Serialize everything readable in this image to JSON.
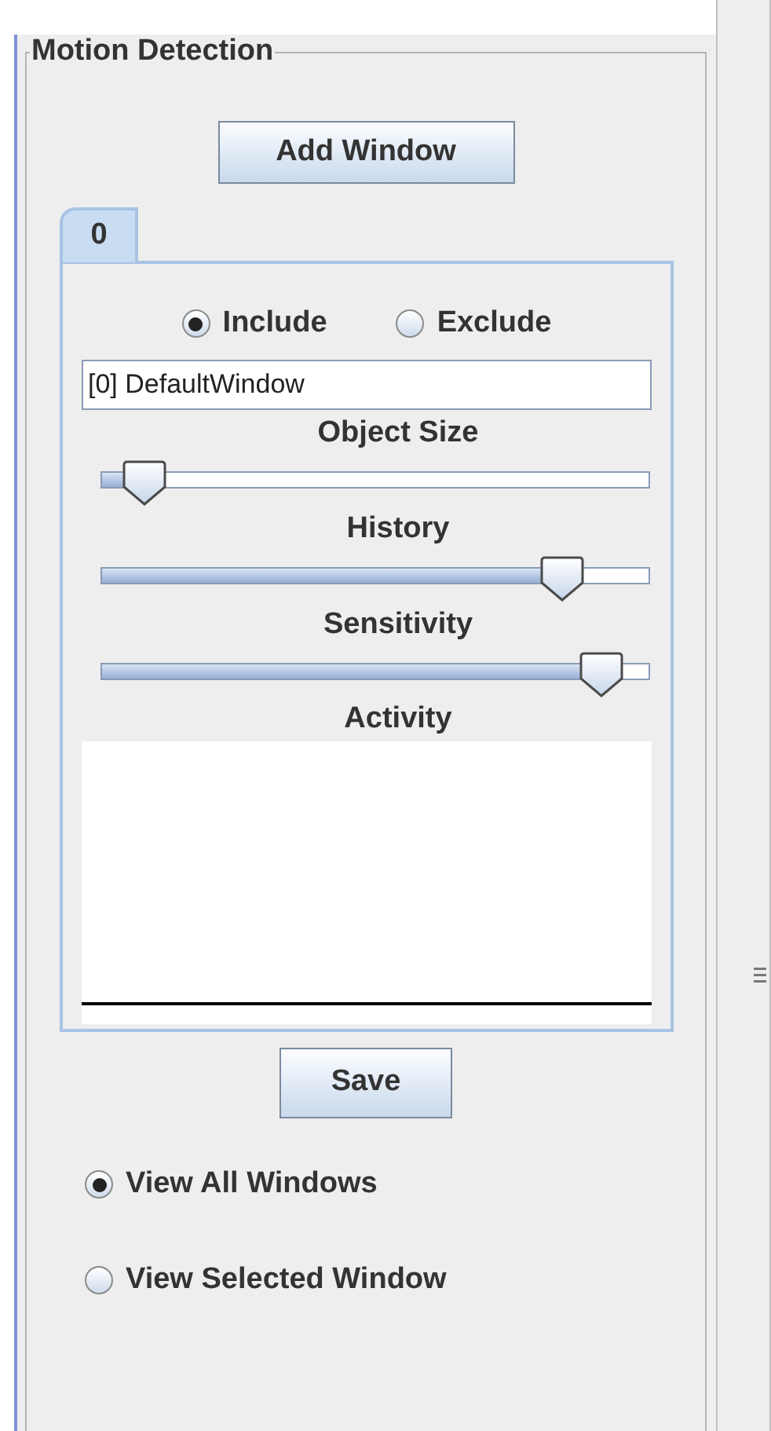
{
  "group_title": "Motion Detection",
  "add_button": "Add Window",
  "tabs": [
    {
      "label": "0",
      "selected": true
    }
  ],
  "region_mode": [
    {
      "label": "Include",
      "selected": true
    },
    {
      "label": "Exclude",
      "selected": false
    }
  ],
  "window_name": "[0] DefaultWindow",
  "sliders": [
    {
      "label": "Object Size",
      "level": 0.08
    },
    {
      "label": "History",
      "level": 0.84
    },
    {
      "label": "Sensitivity",
      "level": 0.91
    }
  ],
  "activity_label": "Activity",
  "save_button": "Save",
  "view_options": [
    {
      "label": "View All Windows",
      "selected": true
    },
    {
      "label": "View Selected Window",
      "selected": false
    }
  ]
}
